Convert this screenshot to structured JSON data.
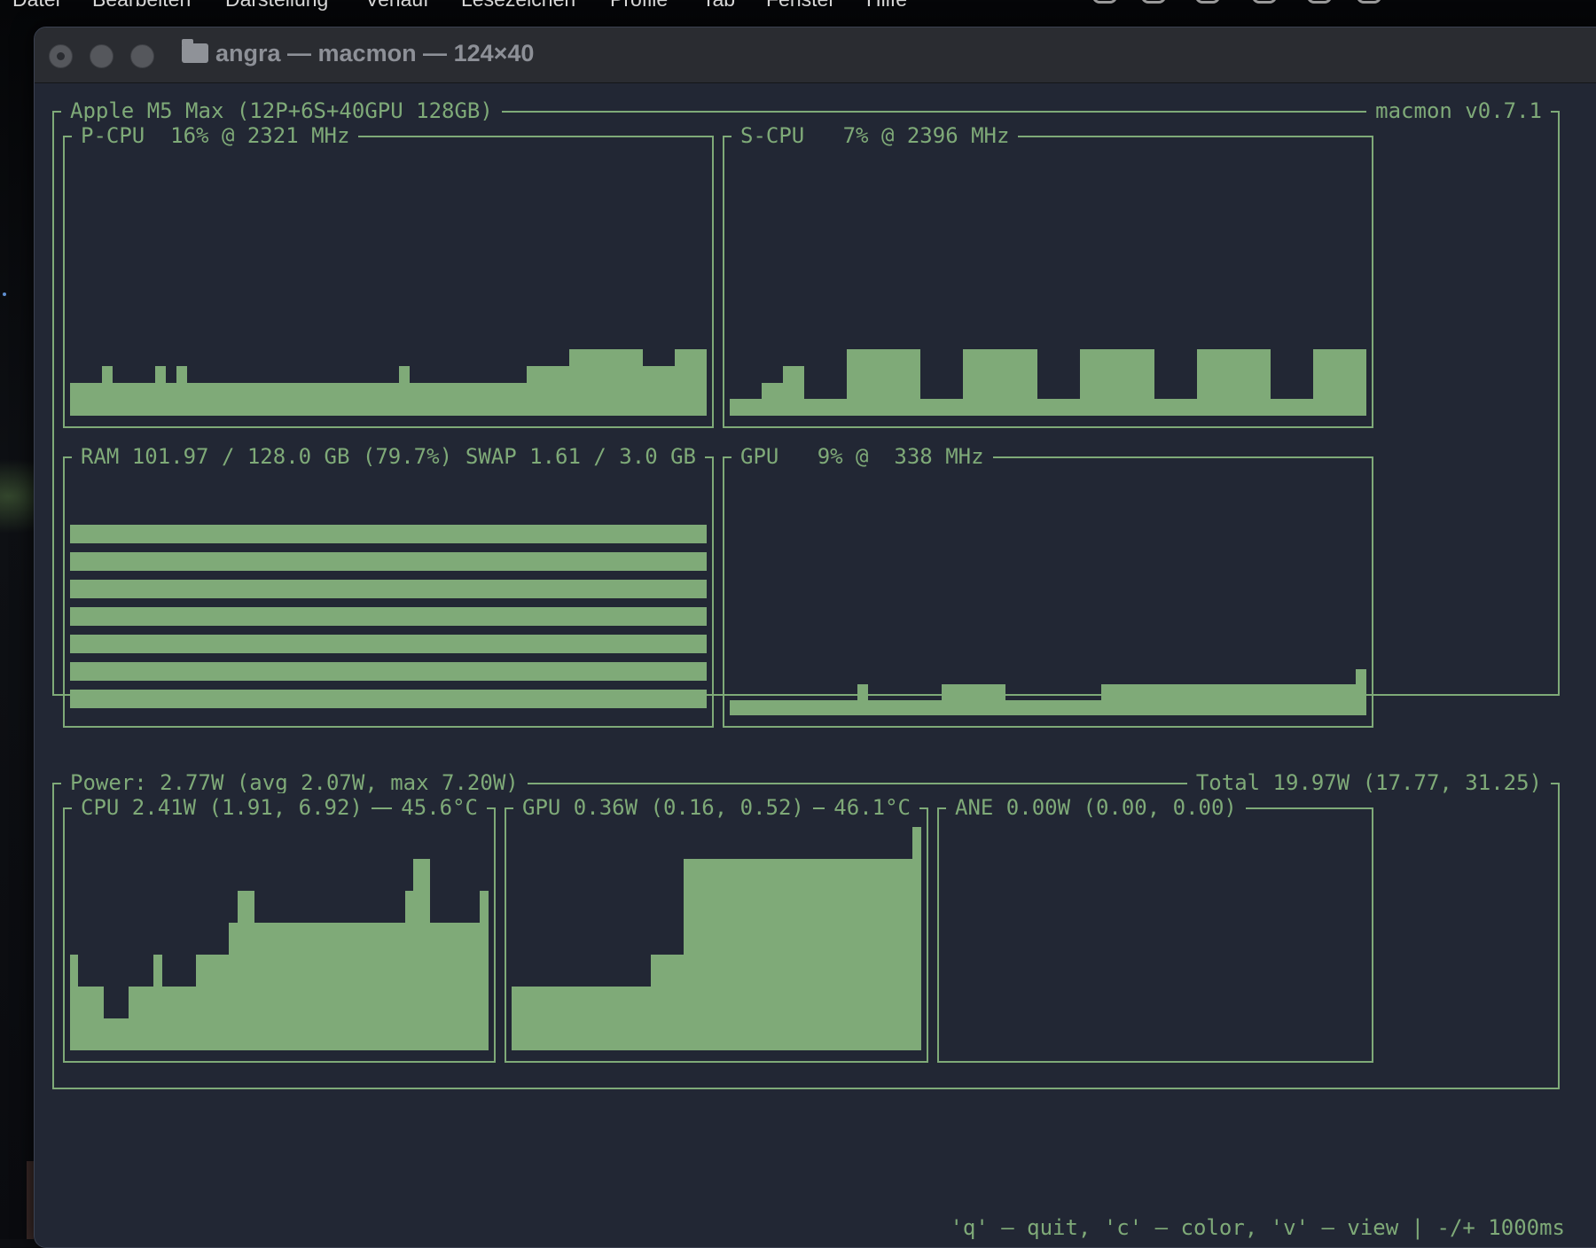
{
  "menubar": {
    "items": [
      "Datei",
      "Bearbeiten",
      "Darstellung",
      "Verlauf",
      "Lesezeichen",
      "Profile",
      "Tab",
      "Fenster",
      "Hilfe"
    ]
  },
  "window": {
    "title": "angra — macmon — 124×40"
  },
  "tui": {
    "header": {
      "chip": "Apple M5 Max (12P+6S+40GPU 128GB)",
      "version": "macmon v0.7.1"
    },
    "pcpu": {
      "label": "P-CPU  16% @ 2321 MHz",
      "history": [
        2,
        2,
        2,
        3,
        2,
        2,
        2,
        2,
        3,
        2,
        3,
        2,
        2,
        2,
        2,
        2,
        2,
        2,
        2,
        2,
        2,
        2,
        2,
        2,
        2,
        2,
        2,
        2,
        2,
        2,
        2,
        3,
        2,
        2,
        2,
        2,
        2,
        2,
        2,
        2,
        2,
        2,
        2,
        3,
        3,
        3,
        3,
        4,
        4,
        4,
        4,
        4,
        4,
        4,
        3,
        3,
        3,
        4,
        4,
        4
      ]
    },
    "scpu": {
      "label": "S-CPU   7% @ 2396 MHz",
      "history": [
        1,
        1,
        1,
        2,
        2,
        3,
        3,
        1,
        1,
        1,
        1,
        4,
        4,
        4,
        4,
        4,
        4,
        4,
        1,
        1,
        1,
        1,
        4,
        4,
        4,
        4,
        4,
        4,
        4,
        1,
        1,
        1,
        1,
        4,
        4,
        4,
        4,
        4,
        4,
        4,
        1,
        1,
        1,
        1,
        4,
        4,
        4,
        4,
        4,
        4,
        4,
        1,
        1,
        1,
        1,
        4,
        4,
        4,
        4,
        4
      ]
    },
    "ram": {
      "label": "RAM 101.97 / 128.0 GB (79.7%)",
      "swap_label": "SWAP 1.61 / 3.0 GB",
      "usage_pct": 79.7
    },
    "gpu": {
      "label": "GPU   9% @  338 MHz",
      "history": [
        1,
        1,
        1,
        1,
        1,
        1,
        1,
        1,
        1,
        1,
        1,
        1,
        2,
        1,
        1,
        1,
        1,
        1,
        1,
        1,
        2,
        2,
        2,
        2,
        2,
        2,
        1,
        1,
        1,
        1,
        1,
        1,
        1,
        1,
        1,
        2,
        2,
        2,
        2,
        2,
        2,
        2,
        2,
        2,
        2,
        2,
        2,
        2,
        2,
        2,
        2,
        2,
        2,
        2,
        2,
        2,
        2,
        2,
        2,
        3
      ]
    },
    "power": {
      "label": "Power: 2.77W (avg 2.07W, max 7.20W)",
      "total_label": "Total 19.97W (17.77, 31.25)"
    },
    "cpu_power": {
      "label": "CPU 2.41W (1.91, 6.92)",
      "temp": "45.6°C",
      "history": [
        3,
        2,
        2,
        2,
        1,
        1,
        1,
        2,
        2,
        2,
        3,
        2,
        2,
        2,
        2,
        3,
        3,
        3,
        3,
        4,
        5,
        5,
        4,
        4,
        4,
        4,
        4,
        4,
        4,
        4,
        4,
        4,
        4,
        4,
        4,
        4,
        4,
        4,
        4,
        4,
        5,
        6,
        6,
        4,
        4,
        4,
        4,
        4,
        4,
        5
      ]
    },
    "gpu_power": {
      "label": "GPU 0.36W (0.16, 0.52)",
      "temp": "46.1°C",
      "history": [
        2,
        2,
        2,
        2,
        2,
        2,
        2,
        2,
        2,
        2,
        2,
        2,
        2,
        2,
        2,
        2,
        2,
        3,
        3,
        3,
        3,
        6,
        6,
        6,
        6,
        6,
        6,
        6,
        6,
        6,
        6,
        6,
        6,
        6,
        6,
        6,
        6,
        6,
        6,
        6,
        6,
        6,
        6,
        6,
        6,
        6,
        6,
        6,
        6,
        7
      ]
    },
    "ane_power": {
      "label": "ANE 0.00W (0.00, 0.00)"
    },
    "footer": {
      "help": "'q' — quit, 'c' — color, 'v' — view | -/+ 1000ms"
    }
  }
}
